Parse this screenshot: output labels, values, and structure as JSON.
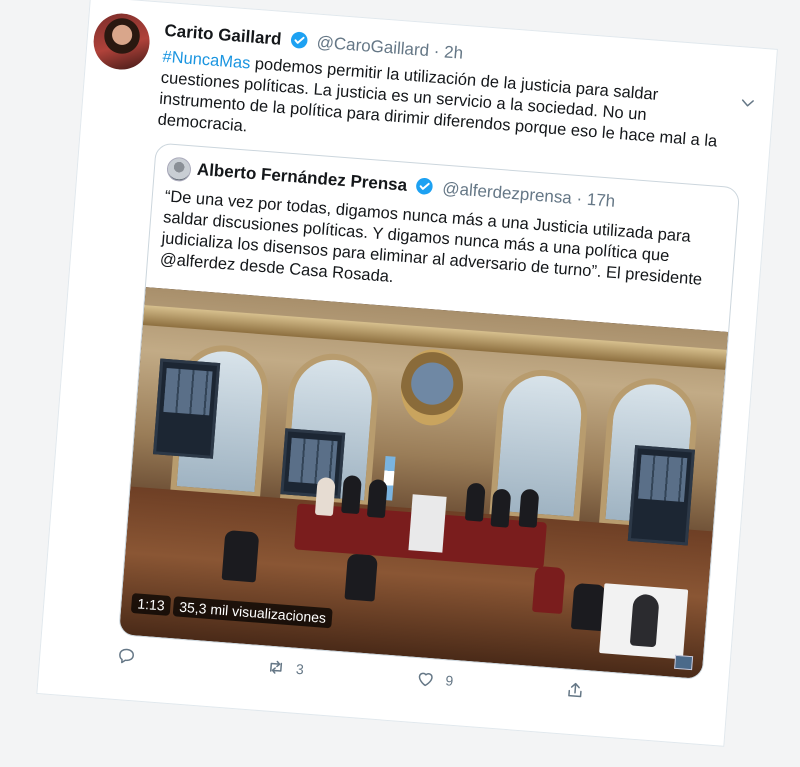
{
  "tweet": {
    "author": {
      "name": "Carito Gaillard",
      "handle": "@CaroGaillard",
      "separator": "·",
      "time": "2h"
    },
    "text": {
      "hashtag": "#NuncaMas",
      "body": " podemos permitir la utilización de la justicia para saldar cuestiones políticas. La justicia es un servicio a la sociedad. No un instrumento de la política para dirimir diferendos porque eso le hace mal a la democracia."
    },
    "quoted": {
      "author": {
        "name": "Alberto Fernández Prensa",
        "handle": "@alferdezprensa",
        "separator": "·",
        "time": "17h"
      },
      "text": "“De una vez por todas, digamos nunca más a una Justicia utilizada para saldar discusiones políticas. Y digamos nunca más a una política que judicializa los disensos para eliminar al adversario de turno”. El presidente @alferdez desde Casa Rosada.",
      "video": {
        "duration": "1:13",
        "views": "35,3 mil visualizaciones"
      }
    },
    "actions": {
      "reply_count": "",
      "retweet_count": "3",
      "like_count": "9"
    }
  },
  "colors": {
    "accent": "#1b95e0",
    "verified": "#1da1f2",
    "secondary_text": "#657786",
    "border": "#ccd6dd"
  },
  "icons": {
    "verified": "verified-badge-icon",
    "caret": "chevron-down-icon",
    "reply": "reply-icon",
    "retweet": "retweet-icon",
    "like": "heart-icon",
    "share": "share-icon"
  }
}
